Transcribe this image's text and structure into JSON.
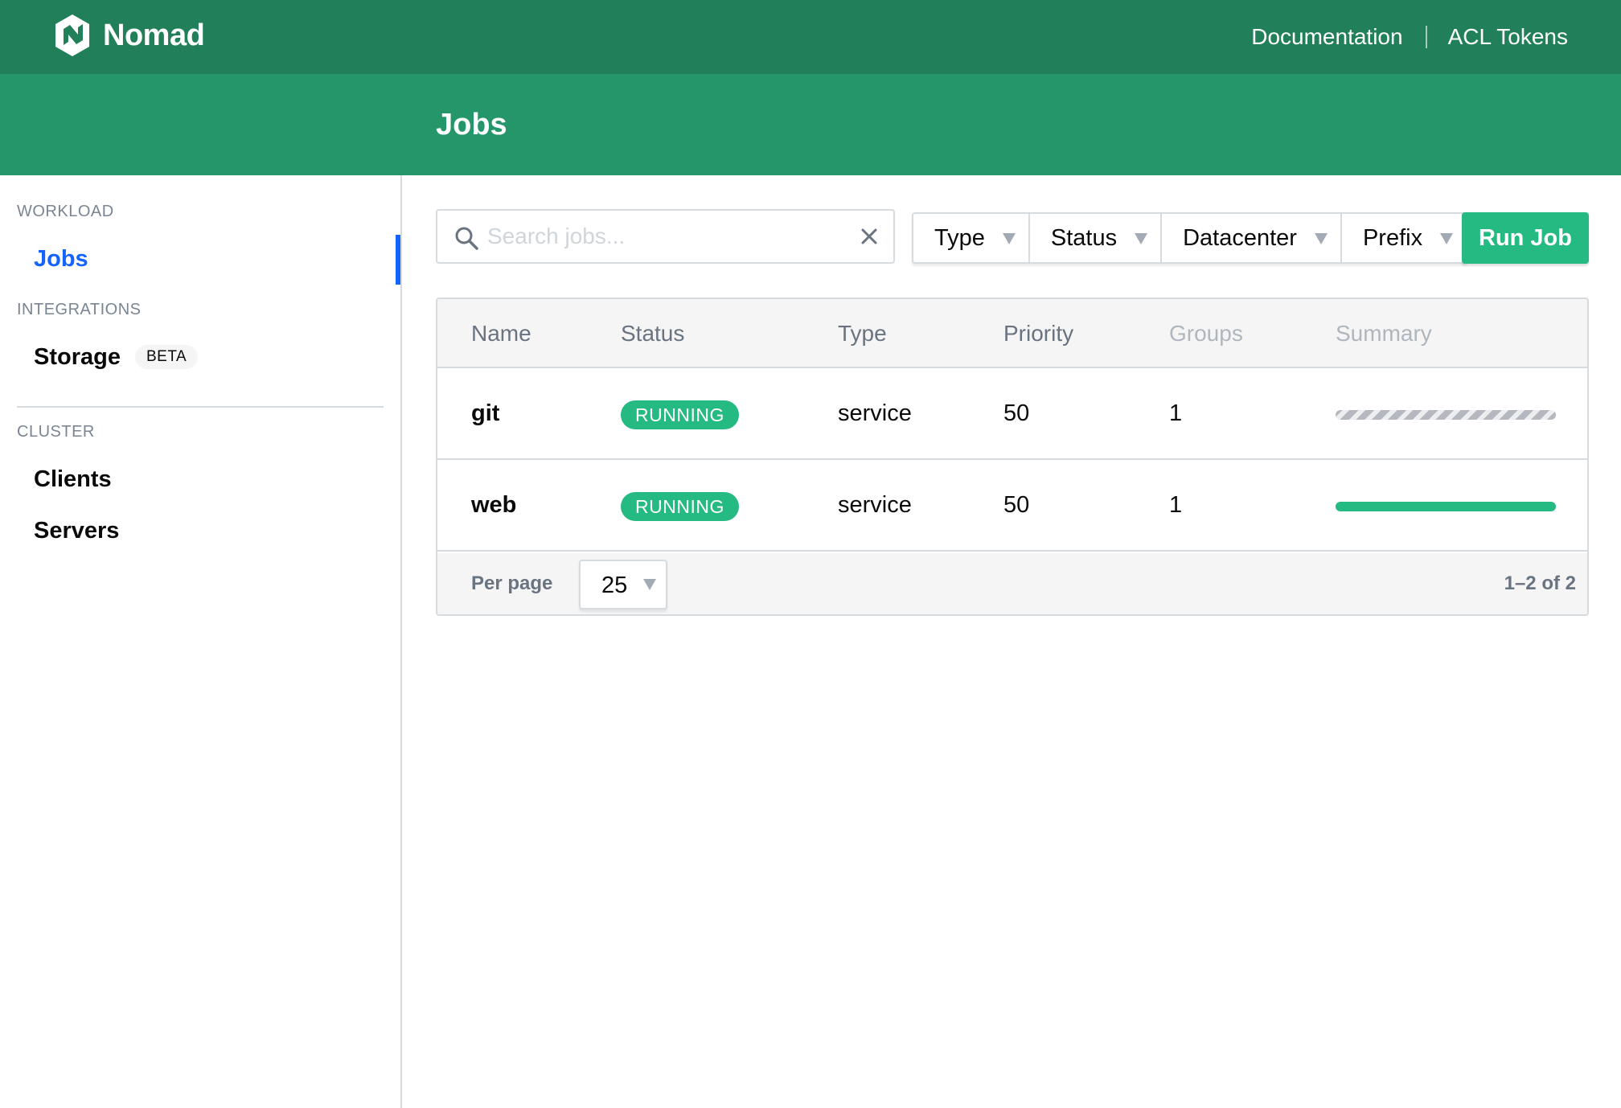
{
  "brand": {
    "name": "Nomad"
  },
  "topnav": {
    "documentation": "Documentation",
    "acl_tokens": "ACL Tokens"
  },
  "page": {
    "title": "Jobs"
  },
  "sidebar": {
    "workload_label": "WORKLOAD",
    "jobs": "Jobs",
    "integrations_label": "INTEGRATIONS",
    "storage": "Storage",
    "storage_badge": "BETA",
    "cluster_label": "CLUSTER",
    "clients": "Clients",
    "servers": "Servers"
  },
  "search": {
    "placeholder": "Search jobs...",
    "value": ""
  },
  "filters": [
    "Type",
    "Status",
    "Datacenter",
    "Prefix"
  ],
  "run_job_label": "Run Job",
  "table": {
    "columns": [
      "Name",
      "Status",
      "Type",
      "Priority",
      "Groups",
      "Summary"
    ],
    "rows": [
      {
        "name": "git",
        "status": "RUNNING",
        "type": "service",
        "priority": "50",
        "groups": "1",
        "summary": "pending"
      },
      {
        "name": "web",
        "status": "RUNNING",
        "type": "service",
        "priority": "50",
        "groups": "1",
        "summary": "running"
      }
    ],
    "per_page_label": "Per page",
    "per_page_value": "25",
    "pager": "1–2 of 2"
  },
  "colors": {
    "nav": "#21805a",
    "header": "#25966a",
    "accent": "#25ba81",
    "active": "#1563ff"
  }
}
